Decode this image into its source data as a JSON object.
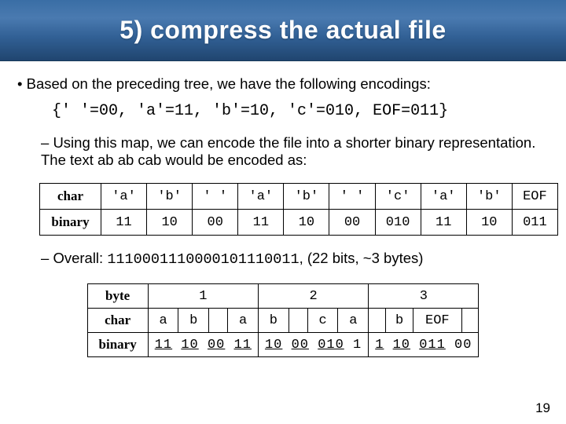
{
  "title": "5) compress the actual file",
  "intro": "Based on the preceding tree, we have the following encodings:",
  "encodings_line": "{' '=00, 'a'=11, 'b'=10, 'c'=010, EOF=011}",
  "using_map": "Using this map, we can encode the file into a shorter binary representation.  The text ab ab cab would be encoded as:",
  "table1": {
    "row_headers": [
      "char",
      "binary"
    ],
    "chars": [
      "'a'",
      "'b'",
      "' '",
      "'a'",
      "'b'",
      "' '",
      "'c'",
      "'a'",
      "'b'",
      "EOF"
    ],
    "binary": [
      "11",
      "10",
      "00",
      "11",
      "10",
      "00",
      "010",
      "11",
      "10",
      "011"
    ]
  },
  "overall_prefix": "Overall: ",
  "overall_bits": "1110001110000101110011",
  "overall_suffix": ", (22 bits, ~3 bytes)",
  "table2": {
    "row_headers": [
      "byte",
      "char",
      "binary"
    ],
    "bytes": [
      "1",
      "2",
      "3"
    ],
    "chars_b1": [
      "a",
      "b",
      "",
      "a"
    ],
    "chars_b2": [
      "b",
      "",
      "c",
      "a"
    ],
    "chars_b3": [
      "",
      "b",
      "EOF",
      ""
    ],
    "bin_b1": {
      "runs": [
        {
          "t": "11",
          "u": true
        },
        {
          "t": " "
        },
        {
          "t": "10",
          "u": true
        },
        {
          "t": " "
        },
        {
          "t": "00",
          "u": true
        },
        {
          "t": " "
        },
        {
          "t": "11",
          "u": true
        }
      ]
    },
    "bin_b2": {
      "runs": [
        {
          "t": "10",
          "u": true
        },
        {
          "t": " "
        },
        {
          "t": "00",
          "u": true
        },
        {
          "t": " "
        },
        {
          "t": "010",
          "u": true
        },
        {
          "t": " "
        },
        {
          "t": "1",
          "u": false
        }
      ]
    },
    "bin_b3": {
      "runs": [
        {
          "t": "1",
          "u": true
        },
        {
          "t": " "
        },
        {
          "t": "10",
          "u": true
        },
        {
          "t": " "
        },
        {
          "t": "011",
          "u": true
        },
        {
          "t": " "
        },
        {
          "t": "00",
          "u": false
        }
      ]
    }
  },
  "page_number": "19"
}
